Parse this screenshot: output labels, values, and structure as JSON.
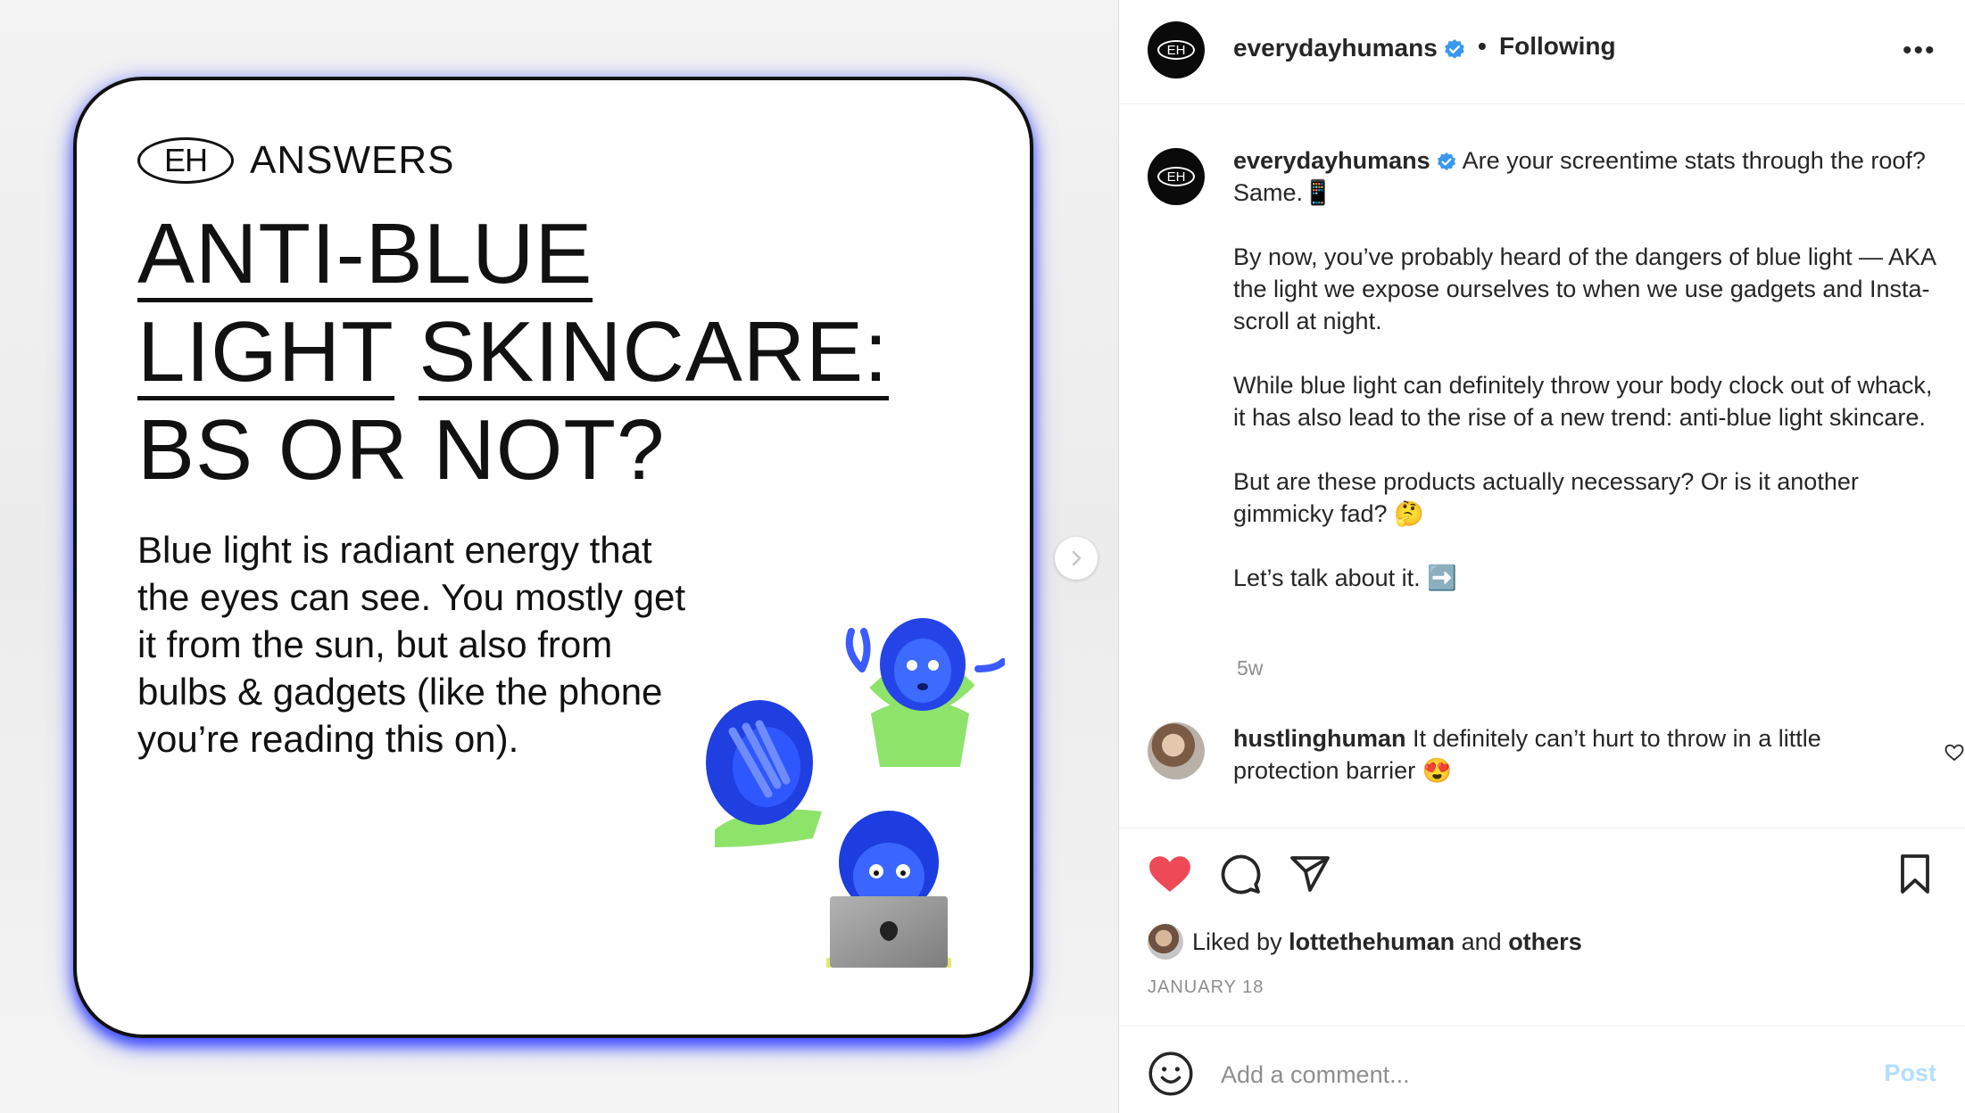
{
  "card": {
    "brand_mark": "EH",
    "brand_label": "ANSWERS",
    "title_lines": [
      "ANTI-BLUE",
      "LIGHT",
      "SKINCARE:",
      "BS OR NOT?"
    ],
    "body": "Blue light is radiant energy that the eyes can see. You mostly get it from the sun, but also from bulbs & gadgets (like the phone you’re reading this on)."
  },
  "header": {
    "avatar_text": "EH",
    "username": "everydayhumans",
    "separator": "•",
    "follow_status": "Following",
    "more": "•••"
  },
  "caption": {
    "username": "everydayhumans",
    "first_line": "Are your screentime stats through the roof? Same.📱",
    "paragraph_2": "By now, you’ve probably heard of the dangers of blue light — AKA the light we expose ourselves to when we use gadgets and Insta-scroll at night.",
    "paragraph_3": "While blue light can definitely throw your body clock out of whack, it has also lead to the rise of a new trend: anti-blue light skincare.",
    "paragraph_4": "But are these products actually necessary? Or is it another gimmicky fad? 🤔",
    "paragraph_5": "Let’s talk about it. ➡️",
    "ago": "5w"
  },
  "comment": {
    "username": "hustlinghuman",
    "text": "It definitely can’t hurt to throw in a little protection barrier 😍"
  },
  "likes": {
    "prefix": "Liked by",
    "user": "lottethehuman",
    "and": "and",
    "others": "others"
  },
  "date": "JANUARY 18",
  "add_comment": {
    "placeholder": "Add a comment...",
    "post_label": "Post"
  },
  "colors": {
    "like_red": "#ed4956",
    "verified_blue": "#3897f0",
    "post_disabled": "#b2dffc",
    "card_glow": "#3a49ff"
  },
  "icons": [
    "verified-badge-icon",
    "more-options-icon",
    "chevron-right-icon",
    "heart-outline-icon",
    "heart-filled-icon",
    "comment-icon",
    "share-icon",
    "bookmark-icon",
    "smile-icon"
  ]
}
